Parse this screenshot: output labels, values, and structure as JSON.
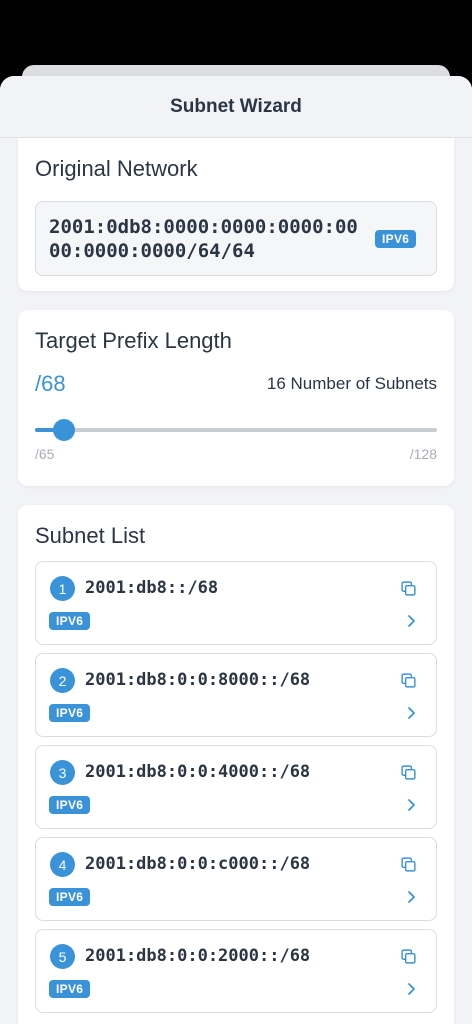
{
  "header": {
    "title": "Subnet Wizard"
  },
  "original_network": {
    "title": "Original Network",
    "address": "2001:0db8:0000:0000:0000:0000:0000:0000/64/64",
    "badge": "IPV6"
  },
  "target_prefix": {
    "title": "Target Prefix Length",
    "value": "/68",
    "subnet_count": "16 Number of Subnets",
    "min_label": "/65",
    "max_label": "/128",
    "slider_fraction": 0.047
  },
  "subnet_list": {
    "title": "Subnet List",
    "items": [
      {
        "index": "1",
        "address": "2001:db8::/68",
        "badge": "IPV6"
      },
      {
        "index": "2",
        "address": "2001:db8:0:0:8000::/68",
        "badge": "IPV6"
      },
      {
        "index": "3",
        "address": "2001:db8:0:0:4000::/68",
        "badge": "IPV6"
      },
      {
        "index": "4",
        "address": "2001:db8:0:0:c000::/68",
        "badge": "IPV6"
      },
      {
        "index": "5",
        "address": "2001:db8:0:0:2000::/68",
        "badge": "IPV6"
      }
    ]
  },
  "colors": {
    "accent": "#3a93d8",
    "background": "#f2f3f6",
    "card": "#ffffff",
    "text": "#2b3644"
  },
  "icons": {
    "copy": "copy-icon",
    "chevron": "chevron-right-icon"
  }
}
